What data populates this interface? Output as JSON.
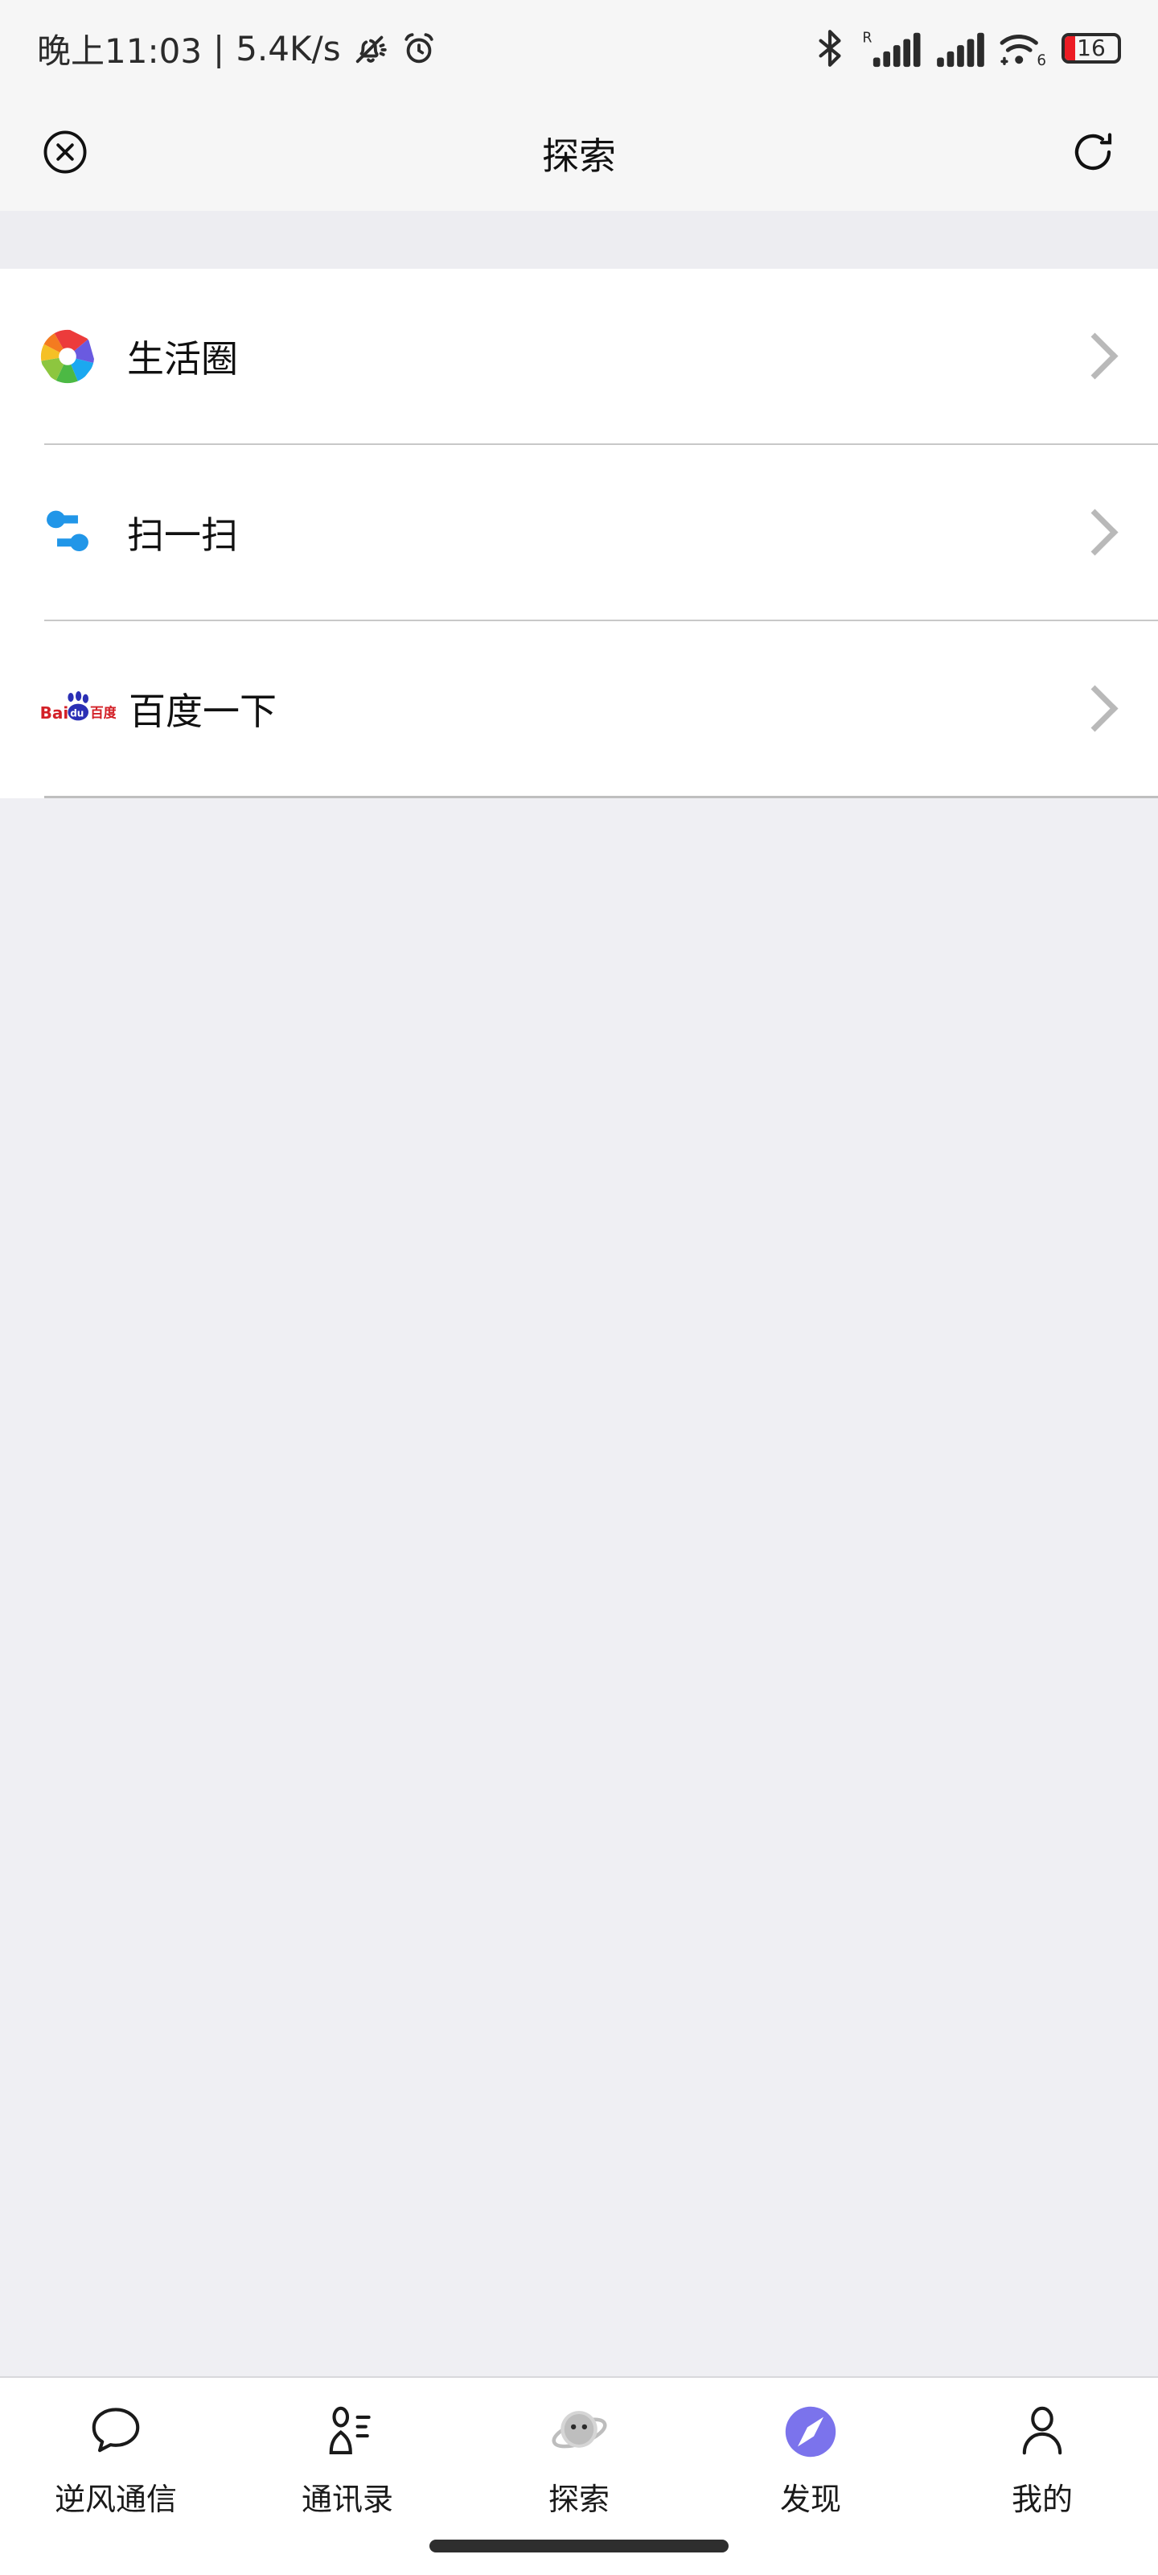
{
  "status_bar": {
    "time": "晚上11:03",
    "separator": "|",
    "net_speed": "5.4K/s",
    "icons_left": [
      "bell-muted-icon",
      "alarm-clock-icon"
    ],
    "icons_right": [
      "bluetooth-icon",
      "signal-roaming-icon",
      "signal-icon",
      "wifi6-icon",
      "battery-icon"
    ],
    "roaming_label": "R",
    "wifi_generation": "6",
    "battery_percent": "16",
    "battery_fill_color": "#EC1C24",
    "bar_background": "#F6F6F6"
  },
  "header": {
    "title": "探索",
    "left_icon": "close-circle-icon",
    "right_icon": "refresh-icon",
    "background": "#F6F6F6"
  },
  "list": {
    "items": [
      {
        "label": "生活圈",
        "icon": "aperture-color-icon",
        "chevron": "chevron-right-icon"
      },
      {
        "label": "扫一扫",
        "icon": "scan-swap-arrows-icon",
        "icon_color": "#2196E8",
        "chevron": "chevron-right-icon"
      },
      {
        "label": "百度一下",
        "icon": "baidu-logo-icon",
        "chevron": "chevron-right-icon"
      }
    ],
    "baidu_logo": {
      "latin_text": "Bai",
      "paw_text": "du",
      "cjk_text": "百度",
      "red": "#D32027",
      "blue": "#2B2FB5"
    },
    "divider_color": "#C8C8C8",
    "card_background": "#FFFFFF"
  },
  "page": {
    "background": "#EFEFF3"
  },
  "tab_bar": {
    "active_index": 2,
    "accent_color": "#7B73EC",
    "items": [
      {
        "label": "逆风通信",
        "icon": "chat-bubble-icon"
      },
      {
        "label": "通讯录",
        "icon": "contacts-icon"
      },
      {
        "label": "探索",
        "icon": "explore-planet-icon"
      },
      {
        "label": "发现",
        "icon": "compass-icon"
      },
      {
        "label": "我的",
        "icon": "person-icon"
      }
    ],
    "home_indicator": "home-indicator-bar"
  }
}
